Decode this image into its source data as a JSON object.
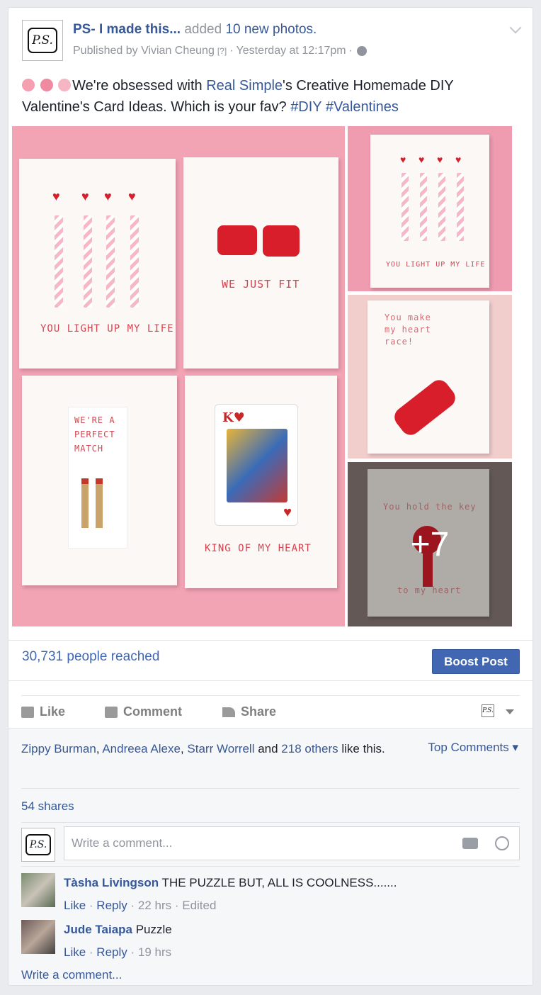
{
  "post": {
    "page_name": "PS- I made this...",
    "action_verb": "added",
    "photo_count_link": "10 new photos.",
    "published_by": "Published by Vivian Cheung",
    "help_mark": "[?]",
    "dot": "·",
    "timestamp": "Yesterday at 12:17pm",
    "avatar_text": "P.S.",
    "text_part1": "We're obsessed with ",
    "text_link": "Real Simple",
    "text_part2": "'s Creative Homemade DIY Valentine's Card Ideas. Which is your fav? ",
    "hashtag1": "#DIY",
    "hashtag2": "#Valentines"
  },
  "photos": {
    "card1_text": "YOU LIGHT UP MY LIFE",
    "card2_text": "WE JUST FIT",
    "card3_text": "WE'RE A PERFECT MATCH",
    "card4_text": "KING OF MY HEART",
    "small1_text": "YOU LIGHT UP MY LIFE",
    "small2_text": "You make my heart race!",
    "small3_top": "You hold the key",
    "small3_bottom": "to my heart",
    "more_count": "+7"
  },
  "insights": {
    "reached": "30,731 people reached",
    "boost_label": "Boost Post"
  },
  "actions": {
    "like": "Like",
    "comment": "Comment",
    "share": "Share",
    "ps_mini": "P.S."
  },
  "engagement": {
    "liker1": "Zippy Burman",
    "sep1": ", ",
    "liker2": "Andreea Alexe",
    "sep2": ", ",
    "liker3": "Starr Worrell",
    "and": " and ",
    "others": "218 others",
    "like_this": " like this.",
    "top_comments": "Top Comments ▾",
    "shares": "54 shares",
    "comment_placeholder": "Write a comment...",
    "write_comment": "Write a comment..."
  },
  "comments": [
    {
      "name": "Tàsha Livingson",
      "text": " THE PUZZLE BUT, ALL IS COOLNESS.......",
      "like": "Like",
      "reply": "Reply",
      "time": "22 hrs",
      "edited": "Edited"
    },
    {
      "name": "Jude Taiapa",
      "text": " Puzzle",
      "like": "Like",
      "reply": "Reply",
      "time": "19 hrs"
    }
  ],
  "colors": {
    "link_blue": "#365899",
    "boost_blue": "#4267b2",
    "photo_pink": "#f2a3b4"
  }
}
